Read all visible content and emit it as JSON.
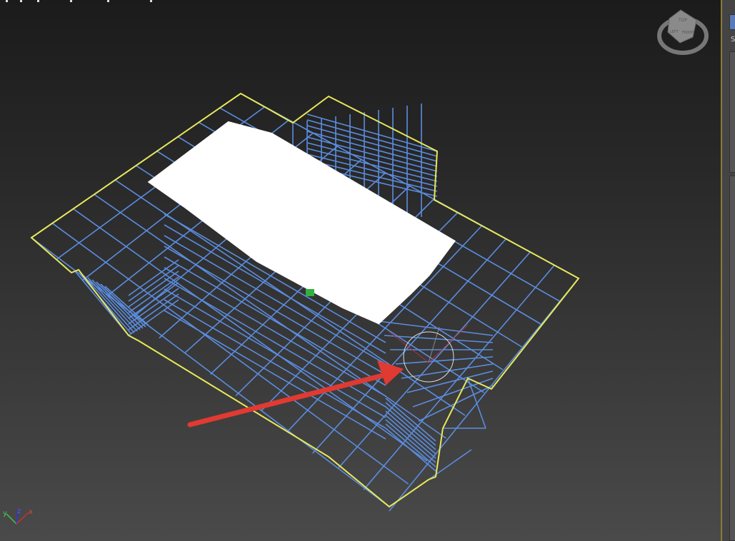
{
  "viewport": {
    "viewcube": {
      "top": "TOP",
      "left": "LEFT",
      "front": "FRONT"
    },
    "axis_tripod": {
      "x": "x",
      "y": "y",
      "z": "z"
    },
    "gizmo_labels": {
      "x": "x",
      "y": "y",
      "z": "z"
    },
    "colors": {
      "wire": "#5b8de0",
      "selection": "#e8e85a",
      "arrow": "#e03a32",
      "background_top": "#1b1b1b",
      "background_bottom": "#4a4a4a"
    }
  },
  "panel": {
    "tab_letter": "S"
  }
}
